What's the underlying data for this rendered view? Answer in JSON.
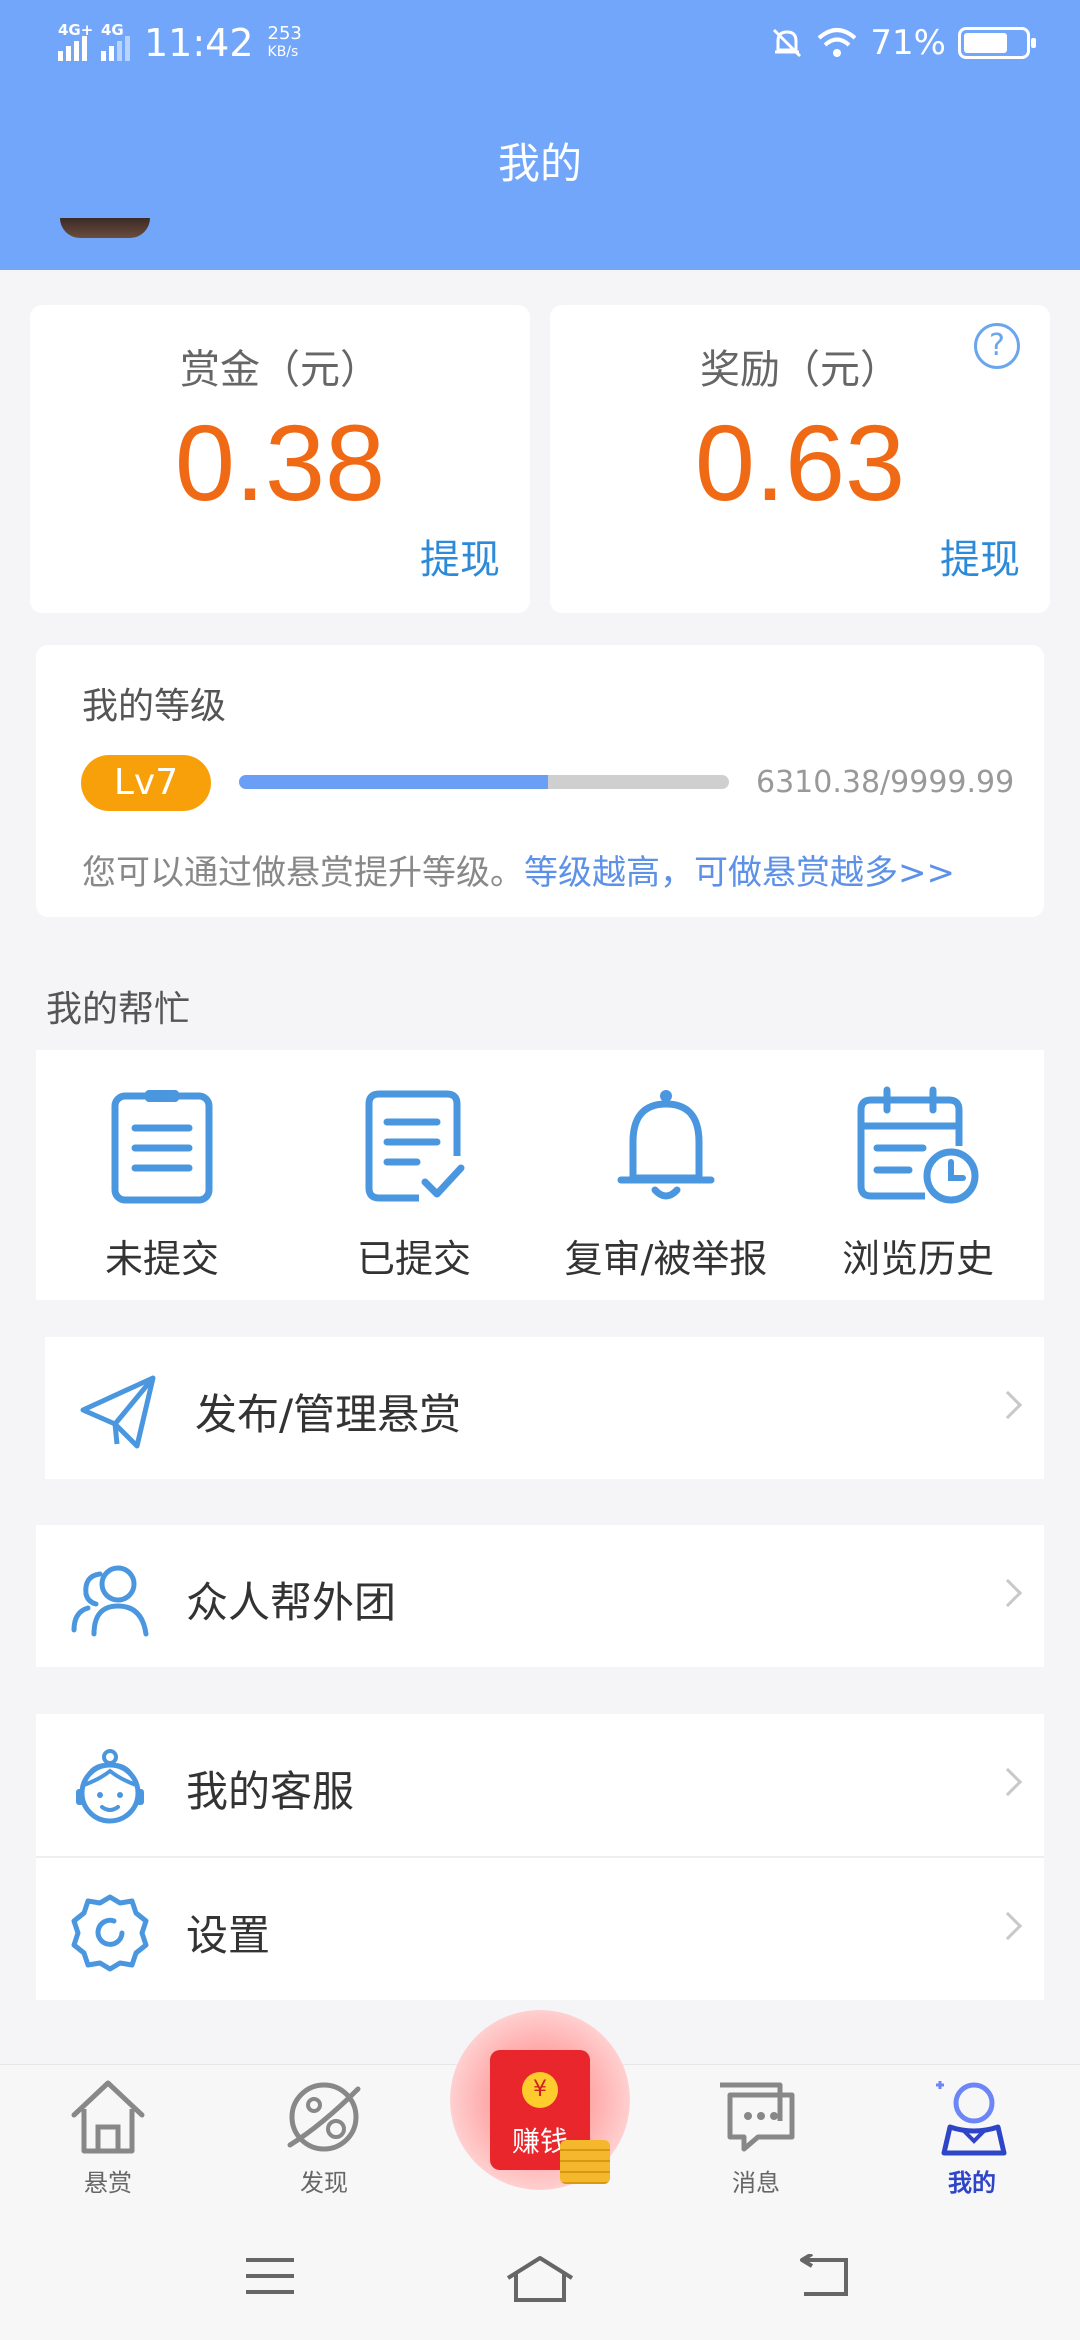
{
  "status_bar": {
    "net1": "4G+",
    "net2": "4G",
    "time": "11:42",
    "speed_value": "253",
    "speed_unit": "KB/s",
    "battery": "71%",
    "battery_level": 0.71
  },
  "header": {
    "title": "我的"
  },
  "balance": {
    "bounty_label": "赏金（元）",
    "bounty_value": "0.38",
    "bounty_action": "提现",
    "reward_label": "奖励（元）",
    "reward_value": "0.63",
    "reward_action": "提现",
    "help_symbol": "?"
  },
  "level": {
    "title": "我的等级",
    "badge": "Lv7",
    "progress_text": "6310.38/9999.99",
    "progress_fraction": 0.631,
    "tip": "您可以通过做悬赏提升等级。",
    "tip_link": "等级越高，可做悬赏越多>>"
  },
  "helps": {
    "title": "我的帮忙",
    "items": [
      {
        "label": "未提交",
        "icon": "clipboard-icon"
      },
      {
        "label": "已提交",
        "icon": "document-check-icon"
      },
      {
        "label": "复审/被举报",
        "icon": "bell-icon"
      },
      {
        "label": "浏览历史",
        "icon": "calendar-clock-icon"
      }
    ]
  },
  "menu": {
    "publish": "发布/管理悬赏",
    "team": "众人帮外团",
    "service": "我的客服",
    "settings": "设置"
  },
  "tabbar": {
    "tabs": [
      {
        "label": "悬赏",
        "icon": "home-icon"
      },
      {
        "label": "发现",
        "icon": "planet-icon"
      },
      {
        "label": "消息",
        "icon": "chat-icon"
      },
      {
        "label": "我的",
        "icon": "user-icon"
      }
    ],
    "center_label": "赚钱",
    "center_coin": "¥",
    "active_color": "#2f45c8"
  },
  "colors": {
    "header": "#72a6fb",
    "amount": "#f06a16",
    "action": "#2d8ad8",
    "badge": "#f7a00a"
  }
}
